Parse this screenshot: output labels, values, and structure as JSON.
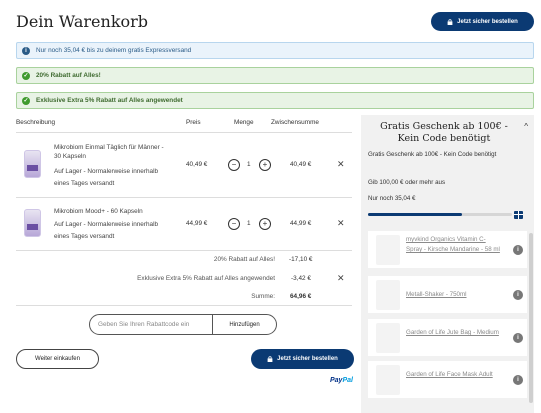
{
  "header": {
    "title": "Dein Warenkorb",
    "checkout_label": "Jetzt sicher bestellen"
  },
  "notices": {
    "shipping": "Nur noch 35,04 € bis zu deinem gratis Expressversand",
    "discount": "20% Rabatt auf Alles!",
    "extra": "Exklusive Extra 5% Rabatt auf Alles angewendet"
  },
  "table": {
    "headers": {
      "description": "Beschreibung",
      "price": "Preis",
      "quantity": "Menge",
      "subtotal": "Zwischensumme"
    },
    "items": [
      {
        "name": "Mikrobiom Einmal Täglich für Männer - 30 Kapseln",
        "stock": "Auf Lager - Normalerweise innerhalb eines Tages versandt",
        "price": "40,49 €",
        "qty": "1",
        "subtotal": "40,49 €"
      },
      {
        "name": "Mikrobiom Mood+ - 60 Kapseln",
        "stock": "Auf Lager - Normalerweise innerhalb eines Tages versandt",
        "price": "44,99 €",
        "qty": "1",
        "subtotal": "44,99 €"
      }
    ]
  },
  "summary": {
    "discount_label": "20% Rabatt auf Alles!",
    "discount_value": "-17,10 €",
    "extra_label": "Exklusive Extra 5% Rabatt auf Alles angewendet",
    "extra_value": "-3,42 €",
    "total_label": "Summe:",
    "total_value": "64,96 €"
  },
  "coupon": {
    "placeholder": "Geben Sie Ihren Rabattcode ein",
    "apply_label": "Hinzufügen"
  },
  "actions": {
    "continue_label": "Weiter einkaufen",
    "checkout_label": "Jetzt sicher bestellen",
    "paypal_pay": "Pay",
    "paypal_pal": "Pal"
  },
  "gift_panel": {
    "title": "Gratis Geschenk ab 100€ - Kein Code benötigt",
    "subtitle": "Gratis Geschenk ab 100€ - Kein Code benötigt",
    "threshold": "Gib 100,00 € oder mehr aus",
    "remaining": "Nur noch 35,04 €",
    "progress": 0.65,
    "gifts": [
      {
        "name": "myvkind Organics Vitamin C-Spray - Kirsche Mandarine - 58 ml"
      },
      {
        "name": "Metall-Shaker - 750ml"
      },
      {
        "name": "Garden of Life Jute Bag - Medium"
      },
      {
        "name": "Garden of Life Face Mask Adult"
      }
    ]
  },
  "colors": {
    "brand": "#0b3a73",
    "info_bg": "#eaf3fb",
    "success_bg": "#e8f3e5",
    "paypal_dark": "#003087",
    "paypal_light": "#009cde"
  },
  "icons": {
    "lock": "lock-icon",
    "info": "info-icon",
    "check": "check-icon",
    "remove": "close-icon",
    "minus": "minus-icon",
    "plus": "plus-icon",
    "gift": "gift-icon",
    "chevron": "chevron-up-icon"
  }
}
